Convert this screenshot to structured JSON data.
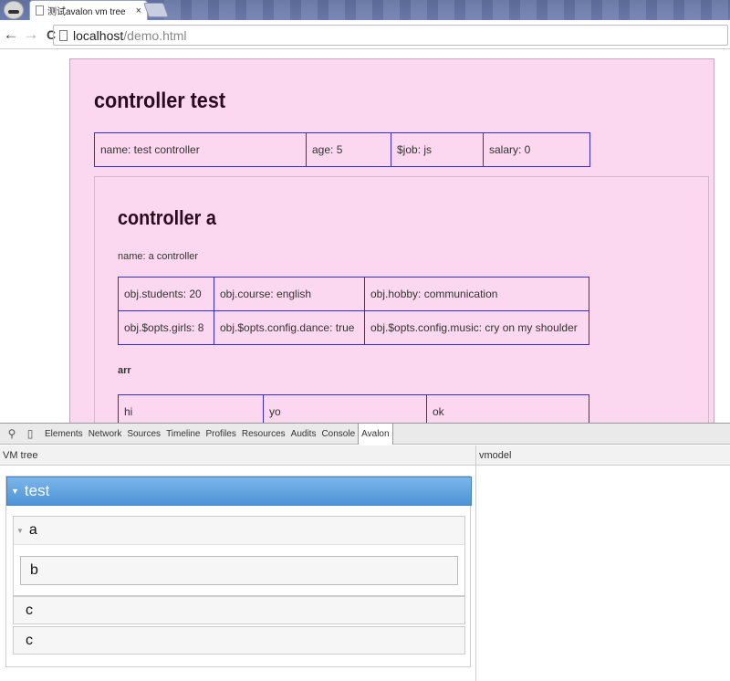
{
  "browser": {
    "tab_title": "测试avalon vm tree",
    "tab_close": "×",
    "url_host": "localhost",
    "url_path": "/demo.html"
  },
  "nav": {
    "back": "←",
    "forward": "→",
    "reload": "C"
  },
  "page": {
    "test": {
      "title": "controller test",
      "cells": [
        "name: test controller",
        "age: 5",
        "$job: js",
        "salary: 0"
      ]
    },
    "a": {
      "title": "controller a",
      "name_line": "name: a controller",
      "obj_rows": [
        [
          "obj.students: 20",
          "obj.course: english",
          "obj.hobby: communication"
        ],
        [
          "obj.$opts.girls: 8",
          "obj.$opts.config.dance: true",
          "obj.$opts.config.music: cry on my shoulder"
        ]
      ],
      "arr_label": "arr",
      "arr_cells": [
        "hi",
        "yo",
        "ok"
      ]
    }
  },
  "devtools": {
    "tabs": [
      "Elements",
      "Network",
      "Sources",
      "Timeline",
      "Profiles",
      "Resources",
      "Audits",
      "Console",
      "Avalon"
    ],
    "active_tab": "Avalon",
    "left_pane_title": "VM tree",
    "right_pane_title": "vmodel",
    "tree": {
      "root": "test",
      "child_a": "a",
      "grandchild_b": "b",
      "child_c1": "c",
      "child_c2": "c"
    }
  },
  "colors": {
    "page_bg": "#fbd8ef",
    "table_border": "#3a2ccc",
    "tree_selected": "#4d93d6"
  }
}
